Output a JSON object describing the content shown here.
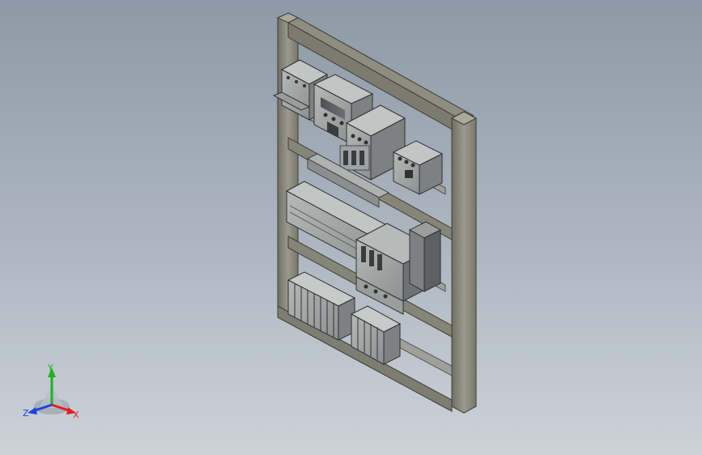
{
  "viewport": {
    "background_top": "#8e99a7",
    "background_bottom": "#cdd2d8"
  },
  "model": {
    "frame_color": "#8c8c7e",
    "component_color": "#a6a8a8",
    "component_dark": "#5e6062",
    "terminal_color": "#b4b6b6"
  },
  "triad": {
    "x_label": "X",
    "y_label": "Y",
    "z_label": "Z",
    "x_color": "#e02020",
    "y_color": "#20b020",
    "z_color": "#2040e0"
  }
}
